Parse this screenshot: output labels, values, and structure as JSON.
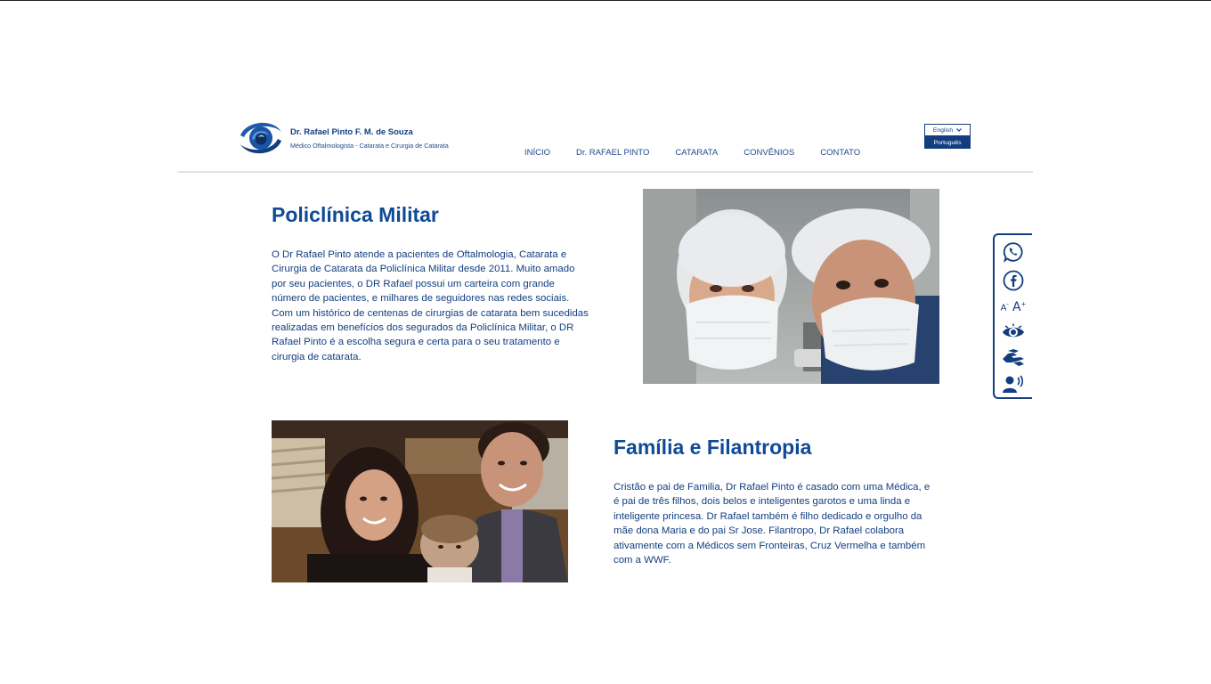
{
  "header": {
    "brand_name": "Dr. Rafael Pinto F. M. de Souza",
    "brand_subtitle": "Médico Oftalmologista - Catarata e Cirurgia de Catarata",
    "logo_icon": "eye-swirl-logo"
  },
  "nav": {
    "items": [
      {
        "label": "INÍCIO"
      },
      {
        "label": "Dr. RAFAEL PINTO"
      },
      {
        "label": "CATARATA"
      },
      {
        "label": "CONVÊNIOS"
      },
      {
        "label": "CONTATO"
      }
    ]
  },
  "language": {
    "selected": "English",
    "option": "Português",
    "icon": "chevron-down-icon"
  },
  "section1": {
    "title": "Policlínica Militar",
    "text": "O Dr Rafael Pinto atende a pacientes de Oftalmologia, Catarata e Cirurgia de Catarata da Policlínica Militar desde 2011. Muito amado por seu pacientes, o DR Rafael possui um carteira com grande número de pacientes, e milhares de seguidores nas redes sociais. Com um histórico de centenas de cirurgias de catarata bem sucedidas realizadas em benefícios dos segurados da Policlínica Militar, o DR Rafael Pinto é a escolha segura e certa para o seu tratamento e cirurgia de catarata."
  },
  "section2": {
    "title": "Família e Filantropia",
    "text": "Cristão e pai de Familia, Dr Rafael Pinto é casado com uma Médica, e é pai de três filhos, dois belos e inteligentes garotos e uma linda e inteligente princesa. Dr Rafael também é filho dedicado e orgulho da mãe dona Maria e do pai Sr Jose. Filantropo, Dr Rafael colabora ativamente com a Médicos sem Fronteiras, Cruz Vermelha e também com a WWF."
  },
  "accessibility": {
    "font_decrease": "A",
    "font_decrease_sup": "-",
    "font_increase": "A",
    "font_increase_sup": "+",
    "icons": [
      "whatsapp-icon",
      "facebook-icon",
      "font-size-icon",
      "contrast-eye-icon",
      "sign-language-icon",
      "screen-reader-icon"
    ]
  },
  "colors": {
    "brand_blue": "#123e80",
    "title_blue": "#0f4a96"
  }
}
